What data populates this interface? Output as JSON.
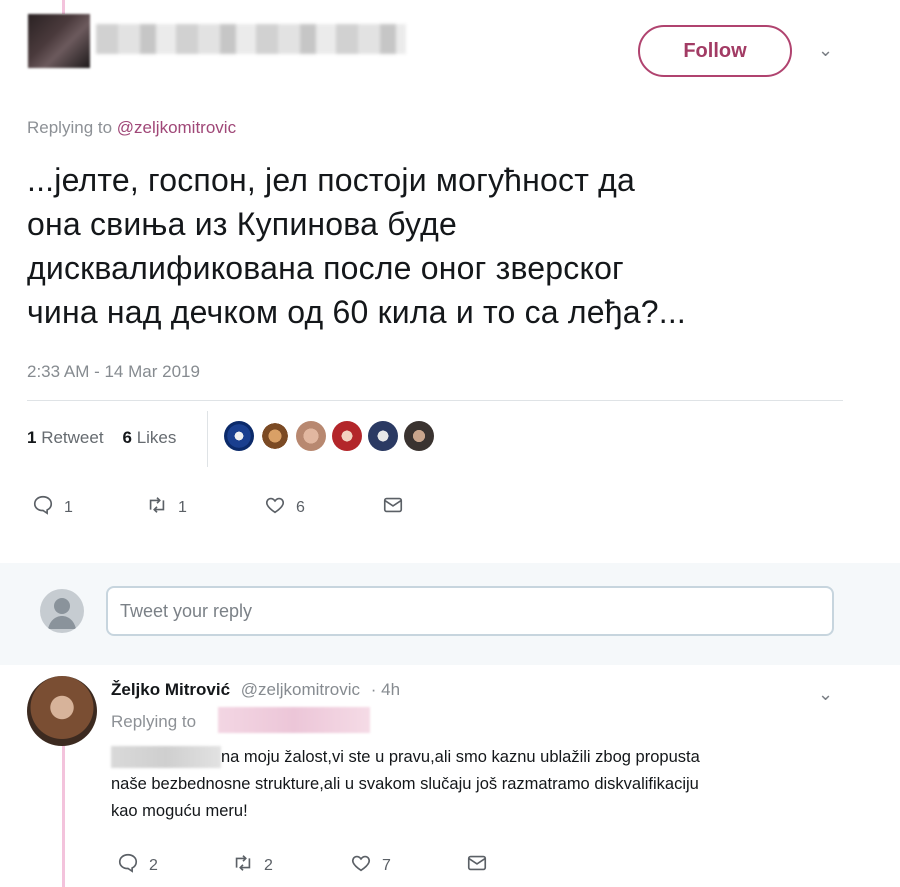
{
  "tweet": {
    "follow_label": "Follow",
    "replying_prefix": "Replying to",
    "replying_handle": "@zeljkomitrovic",
    "text_lines": [
      "...јелте, госпон, јел постоји могућност да",
      "она свиња из Купинова буде",
      "дисквалификована после оног зверског",
      "чина над дечком од 60 кила и то са леђа?..."
    ],
    "timestamp": "2:33 AM - 14 Mar 2019",
    "retweets_count": "1",
    "retweets_label": "Retweet",
    "likes_count": "6",
    "likes_label": "Likes",
    "actions": {
      "reply": "1",
      "retweet": "1",
      "like": "6"
    }
  },
  "reply_box": {
    "placeholder": "Tweet your reply"
  },
  "reply": {
    "name": "Željko Mitrović",
    "handle": "@zeljkomitrovic",
    "time": "· 4h",
    "replying_prefix": "Replying to",
    "text_line1": "na moju žalost,vi ste u pravu,ali smo kaznu ublažili zbog propusta",
    "text_line2": "naše bezbednosne  strukture,ali u svakom slučaju još razmatramo diskvalifikaciju",
    "text_line3": "kao moguću meru!",
    "actions": {
      "reply": "2",
      "retweet": "2",
      "like": "7"
    }
  },
  "colors": {
    "accent": "#a23b64",
    "thread": "#f3c3dc",
    "muted": "#868b90"
  },
  "icons": [
    "chevron-down-icon",
    "reply-icon",
    "retweet-icon",
    "like-icon",
    "message-icon",
    "default-avatar-icon"
  ]
}
